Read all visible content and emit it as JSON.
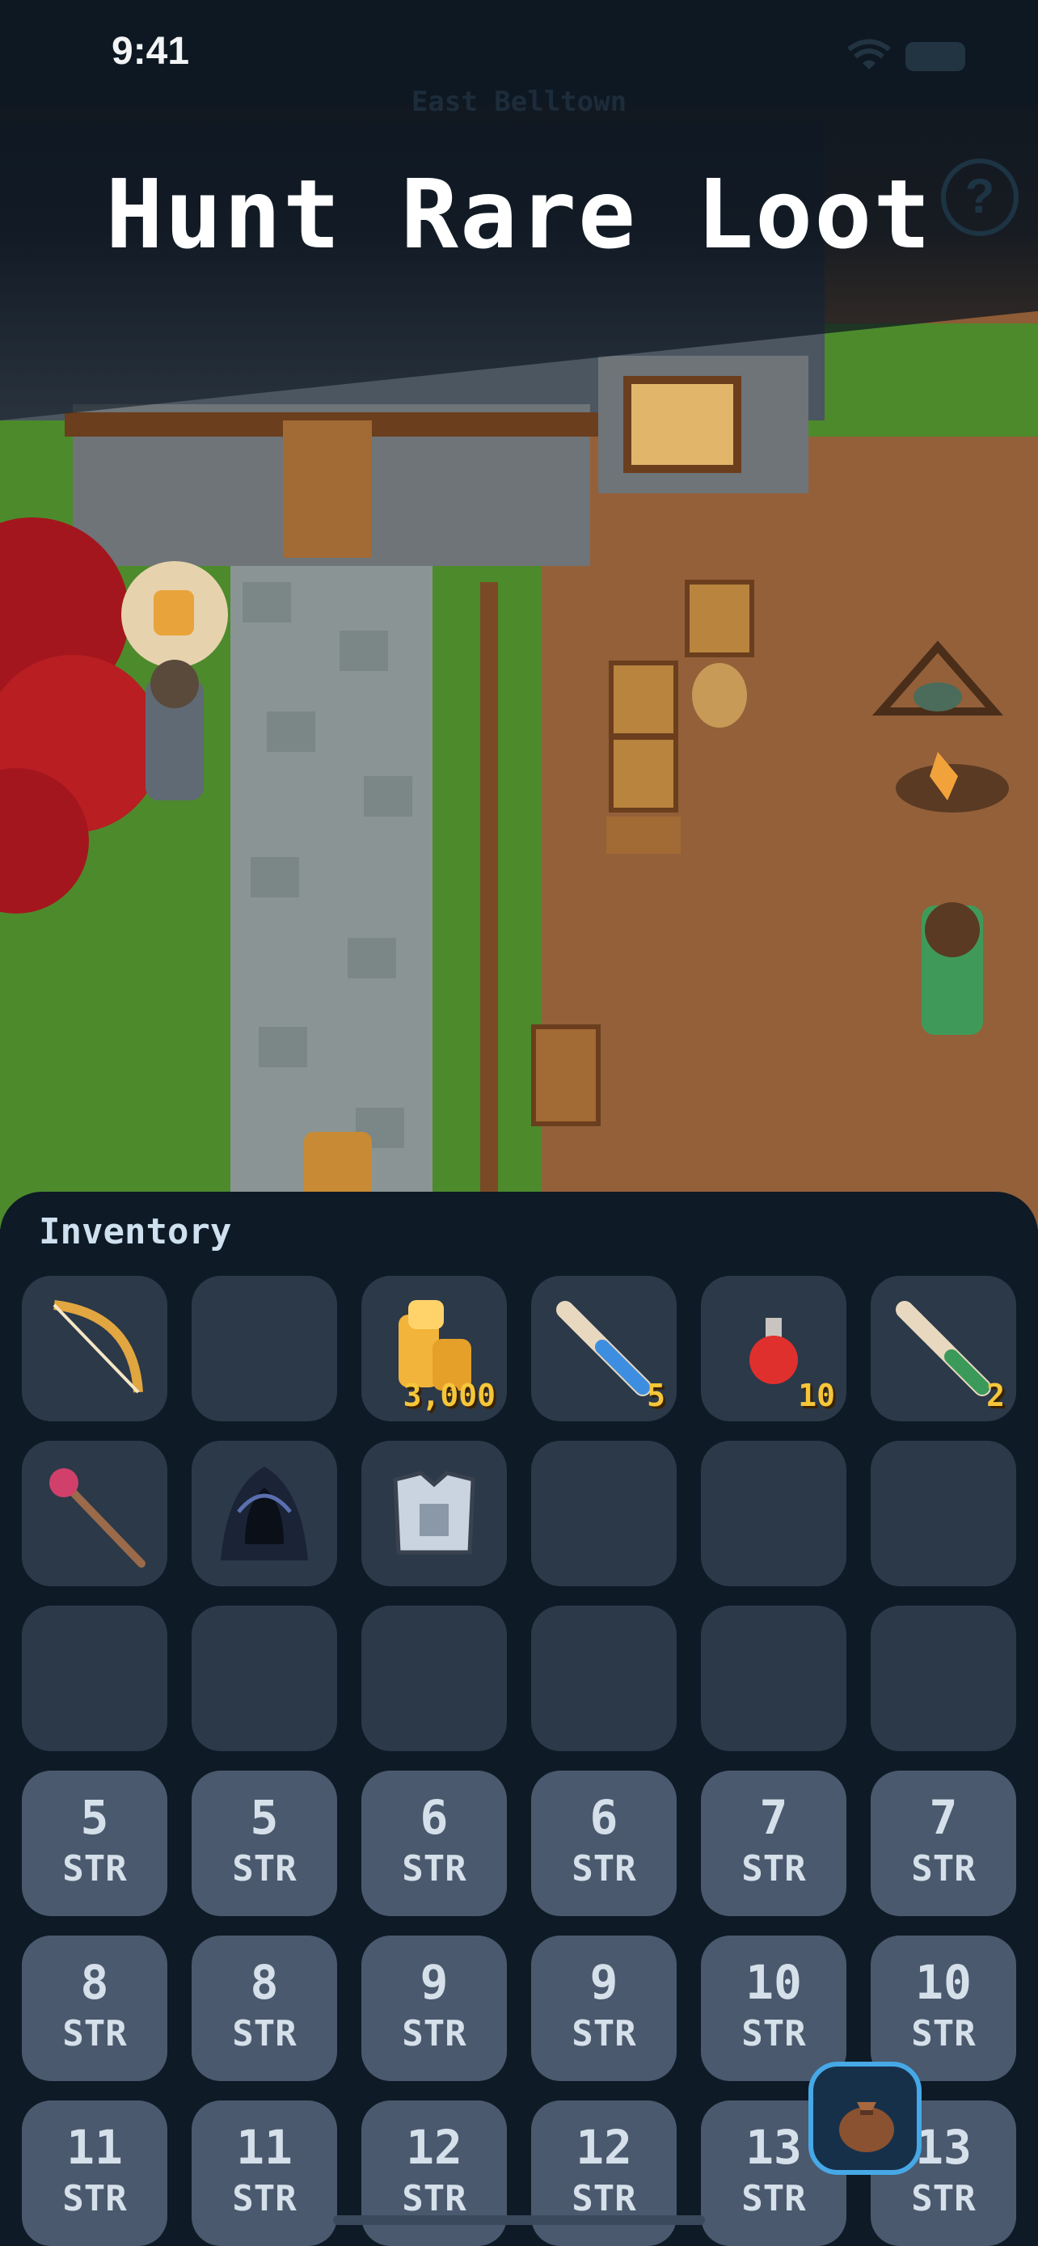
{
  "status_bar": {
    "time": "9:41"
  },
  "header": {
    "location": "East Belltown",
    "headline": "Hunt Rare Loot"
  },
  "inventory": {
    "title": "Inventory",
    "item_slots": [
      {
        "icon": "bow-icon",
        "quantity": ""
      },
      {
        "icon": "",
        "quantity": ""
      },
      {
        "icon": "gold-coins-icon",
        "quantity": "3,000"
      },
      {
        "icon": "blue-scroll-icon",
        "quantity": "5"
      },
      {
        "icon": "red-potion-icon",
        "quantity": "10"
      },
      {
        "icon": "green-scroll-icon",
        "quantity": "2"
      },
      {
        "icon": "staff-icon",
        "quantity": ""
      },
      {
        "icon": "dark-cloak-icon",
        "quantity": ""
      },
      {
        "icon": "chest-armor-icon",
        "quantity": ""
      },
      {
        "icon": "",
        "quantity": ""
      },
      {
        "icon": "",
        "quantity": ""
      },
      {
        "icon": "",
        "quantity": ""
      },
      {
        "icon": "",
        "quantity": ""
      },
      {
        "icon": "",
        "quantity": ""
      },
      {
        "icon": "",
        "quantity": ""
      },
      {
        "icon": "",
        "quantity": ""
      },
      {
        "icon": "",
        "quantity": ""
      },
      {
        "icon": "",
        "quantity": ""
      }
    ],
    "stat_slots": [
      {
        "value": "5",
        "label": "STR"
      },
      {
        "value": "5",
        "label": "STR"
      },
      {
        "value": "6",
        "label": "STR"
      },
      {
        "value": "6",
        "label": "STR"
      },
      {
        "value": "7",
        "label": "STR"
      },
      {
        "value": "7",
        "label": "STR"
      },
      {
        "value": "8",
        "label": "STR"
      },
      {
        "value": "8",
        "label": "STR"
      },
      {
        "value": "9",
        "label": "STR"
      },
      {
        "value": "9",
        "label": "STR"
      },
      {
        "value": "10",
        "label": "STR"
      },
      {
        "value": "10",
        "label": "STR"
      },
      {
        "value": "11",
        "label": "STR"
      },
      {
        "value": "11",
        "label": "STR"
      },
      {
        "value": "12",
        "label": "STR"
      },
      {
        "value": "12",
        "label": "STR"
      },
      {
        "value": "13",
        "label": "STR"
      },
      {
        "value": "13",
        "label": "STR"
      }
    ]
  },
  "colors": {
    "panel": "#0e1a26",
    "slot": "#2b3949",
    "stat_slot": "#4a596d",
    "quantity": "#f6c63a",
    "bag_ring": "#46a8e6"
  }
}
